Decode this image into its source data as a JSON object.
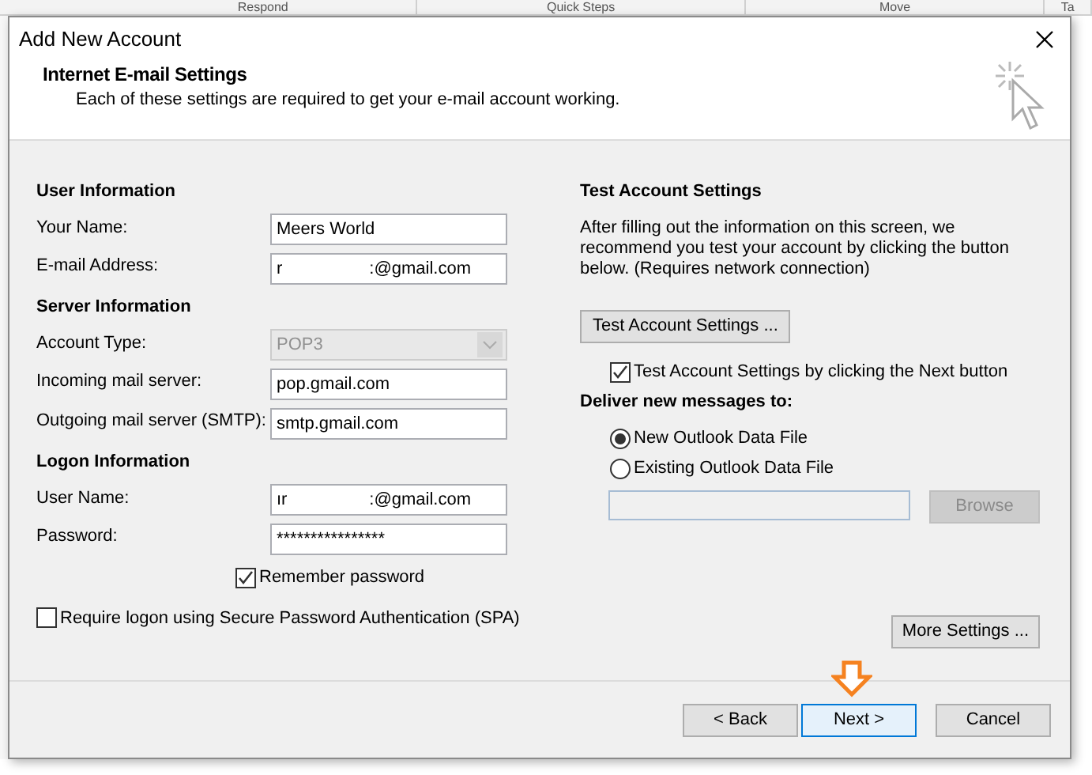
{
  "ribbon": {
    "groups": [
      "Respond",
      "Quick Steps",
      "Move",
      "Ta"
    ]
  },
  "dialog": {
    "title": "Add New Account",
    "header": {
      "title": "Internet E-mail Settings",
      "subtitle": "Each of these settings are required to get your e-mail account working."
    },
    "left_sections": [
      {
        "heading": "User Information",
        "rows": [
          {
            "kind": "text",
            "label": "Your Name:",
            "value": "Meers World"
          },
          {
            "kind": "text",
            "label": "E-mail Address:",
            "value": "r                  :@gmail.com"
          }
        ]
      },
      {
        "heading": "Server Information",
        "rows": [
          {
            "kind": "dropdown",
            "label": "Account Type:",
            "value": "POP3",
            "disabled": true
          },
          {
            "kind": "text",
            "label": "Incoming mail server:",
            "value": "pop.gmail.com"
          },
          {
            "kind": "text",
            "label": "Outgoing mail server (SMTP):",
            "value": "smtp.gmail.com"
          }
        ]
      },
      {
        "heading": "Logon Information",
        "rows": [
          {
            "kind": "text",
            "label": "User Name:",
            "value": "ır                 :@gmail.com"
          },
          {
            "kind": "text",
            "label": "Password:",
            "value": "****************"
          },
          {
            "kind": "checkbox",
            "label": "Remember password",
            "checked": true
          }
        ]
      }
    ],
    "spa_checkbox": {
      "label": "Require logon using Secure Password Authentication (SPA)",
      "checked": false
    },
    "test": {
      "heading": "Test Account Settings",
      "text": "After filling out the information on this screen, we recommend you test your account by clicking the button below. (Requires network connection)",
      "button": "Test Account Settings ...",
      "checkbox": {
        "label": "Test Account Settings by clicking the Next button",
        "checked": true
      }
    },
    "deliver": {
      "heading": "Deliver new messages to:",
      "options": [
        {
          "label": "New Outlook Data File",
          "selected": true
        },
        {
          "label": "Existing Outlook Data File",
          "selected": false
        }
      ],
      "browse": {
        "label": "Browse",
        "disabled": true
      }
    },
    "more_settings": "More Settings ...",
    "footer_buttons": [
      {
        "label": "< Back",
        "default": false,
        "pointer_arrow": false
      },
      {
        "label": "Next >",
        "default": true,
        "pointer_arrow": true
      },
      {
        "label": "Cancel",
        "default": false,
        "pointer_arrow": false
      }
    ]
  }
}
